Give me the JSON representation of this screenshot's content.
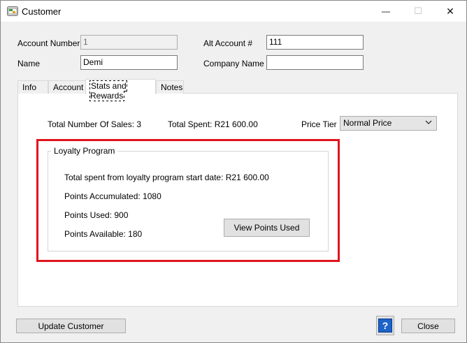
{
  "window": {
    "title": "Customer",
    "minimize_glyph": "—",
    "maximize_glyph": "☐",
    "close_glyph": "✕"
  },
  "fields": {
    "account_number": {
      "label": "Account Number",
      "value": "1"
    },
    "alt_account": {
      "label": "Alt Account #",
      "value": "111"
    },
    "name": {
      "label": "Name",
      "value": "Demi"
    },
    "company_name": {
      "label": "Company Name",
      "value": ""
    }
  },
  "tabs": [
    {
      "label": "Info"
    },
    {
      "label": "Account"
    },
    {
      "label": "Stats and Rewards"
    },
    {
      "label": "Notes"
    }
  ],
  "stats": {
    "total_sales": "Total Number Of Sales: 3",
    "total_spent": "Total Spent: R21 600.00",
    "price_tier_label": "Price Tier",
    "price_tier_value": "Normal Price"
  },
  "loyalty": {
    "title": "Loyalty Program",
    "spent_since_start": "Total spent from loyalty program start date: R21 600.00",
    "points_accumulated": "Points Accumulated: 1080",
    "points_used": "Points Used: 900",
    "points_available": "Points Available: 180",
    "view_points_button": "View Points Used"
  },
  "footer": {
    "update_button": "Update Customer",
    "help_glyph": "?",
    "close_button": "Close"
  },
  "colors": {
    "highlight": "#e0141e",
    "help_blue": "#1d63c8"
  }
}
